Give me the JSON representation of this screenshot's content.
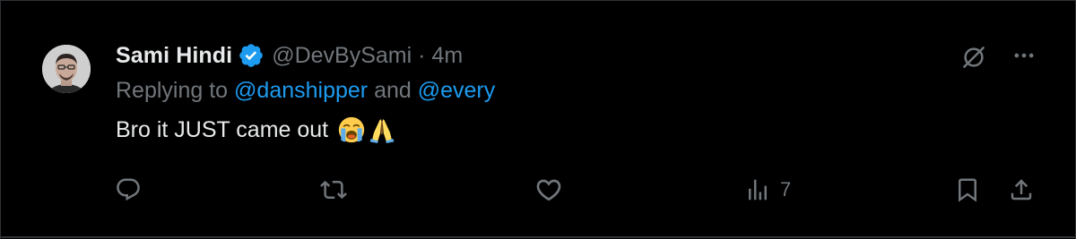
{
  "tweet": {
    "author": {
      "display_name": "Sami Hindi",
      "handle": "@DevBySami",
      "verified": true
    },
    "separator": "·",
    "timestamp": "4m",
    "replying_to": {
      "prefix": "Replying to",
      "mention_1": "@danshipper",
      "conjunction": "and",
      "mention_2": "@every"
    },
    "text": "Bro it JUST came out",
    "emojis": [
      "loudly-crying-face-emoji",
      "folded-hands-emoji"
    ],
    "actions": {
      "reply_icon": "reply-bubble-icon",
      "retweet_icon": "retweet-icon",
      "like_icon": "heart-icon",
      "views_icon": "bar-chart-icon",
      "views_count": "7",
      "bookmark_icon": "bookmark-icon",
      "share_icon": "share-icon"
    },
    "top_icons": {
      "grok_icon": "grok-icon",
      "more_icon": "more-horizontal-icon"
    }
  },
  "colors": {
    "background": "#000000",
    "text_primary": "#e7e9ea",
    "text_secondary": "#71767b",
    "accent": "#1d9bf0",
    "divider": "#2f3336"
  }
}
